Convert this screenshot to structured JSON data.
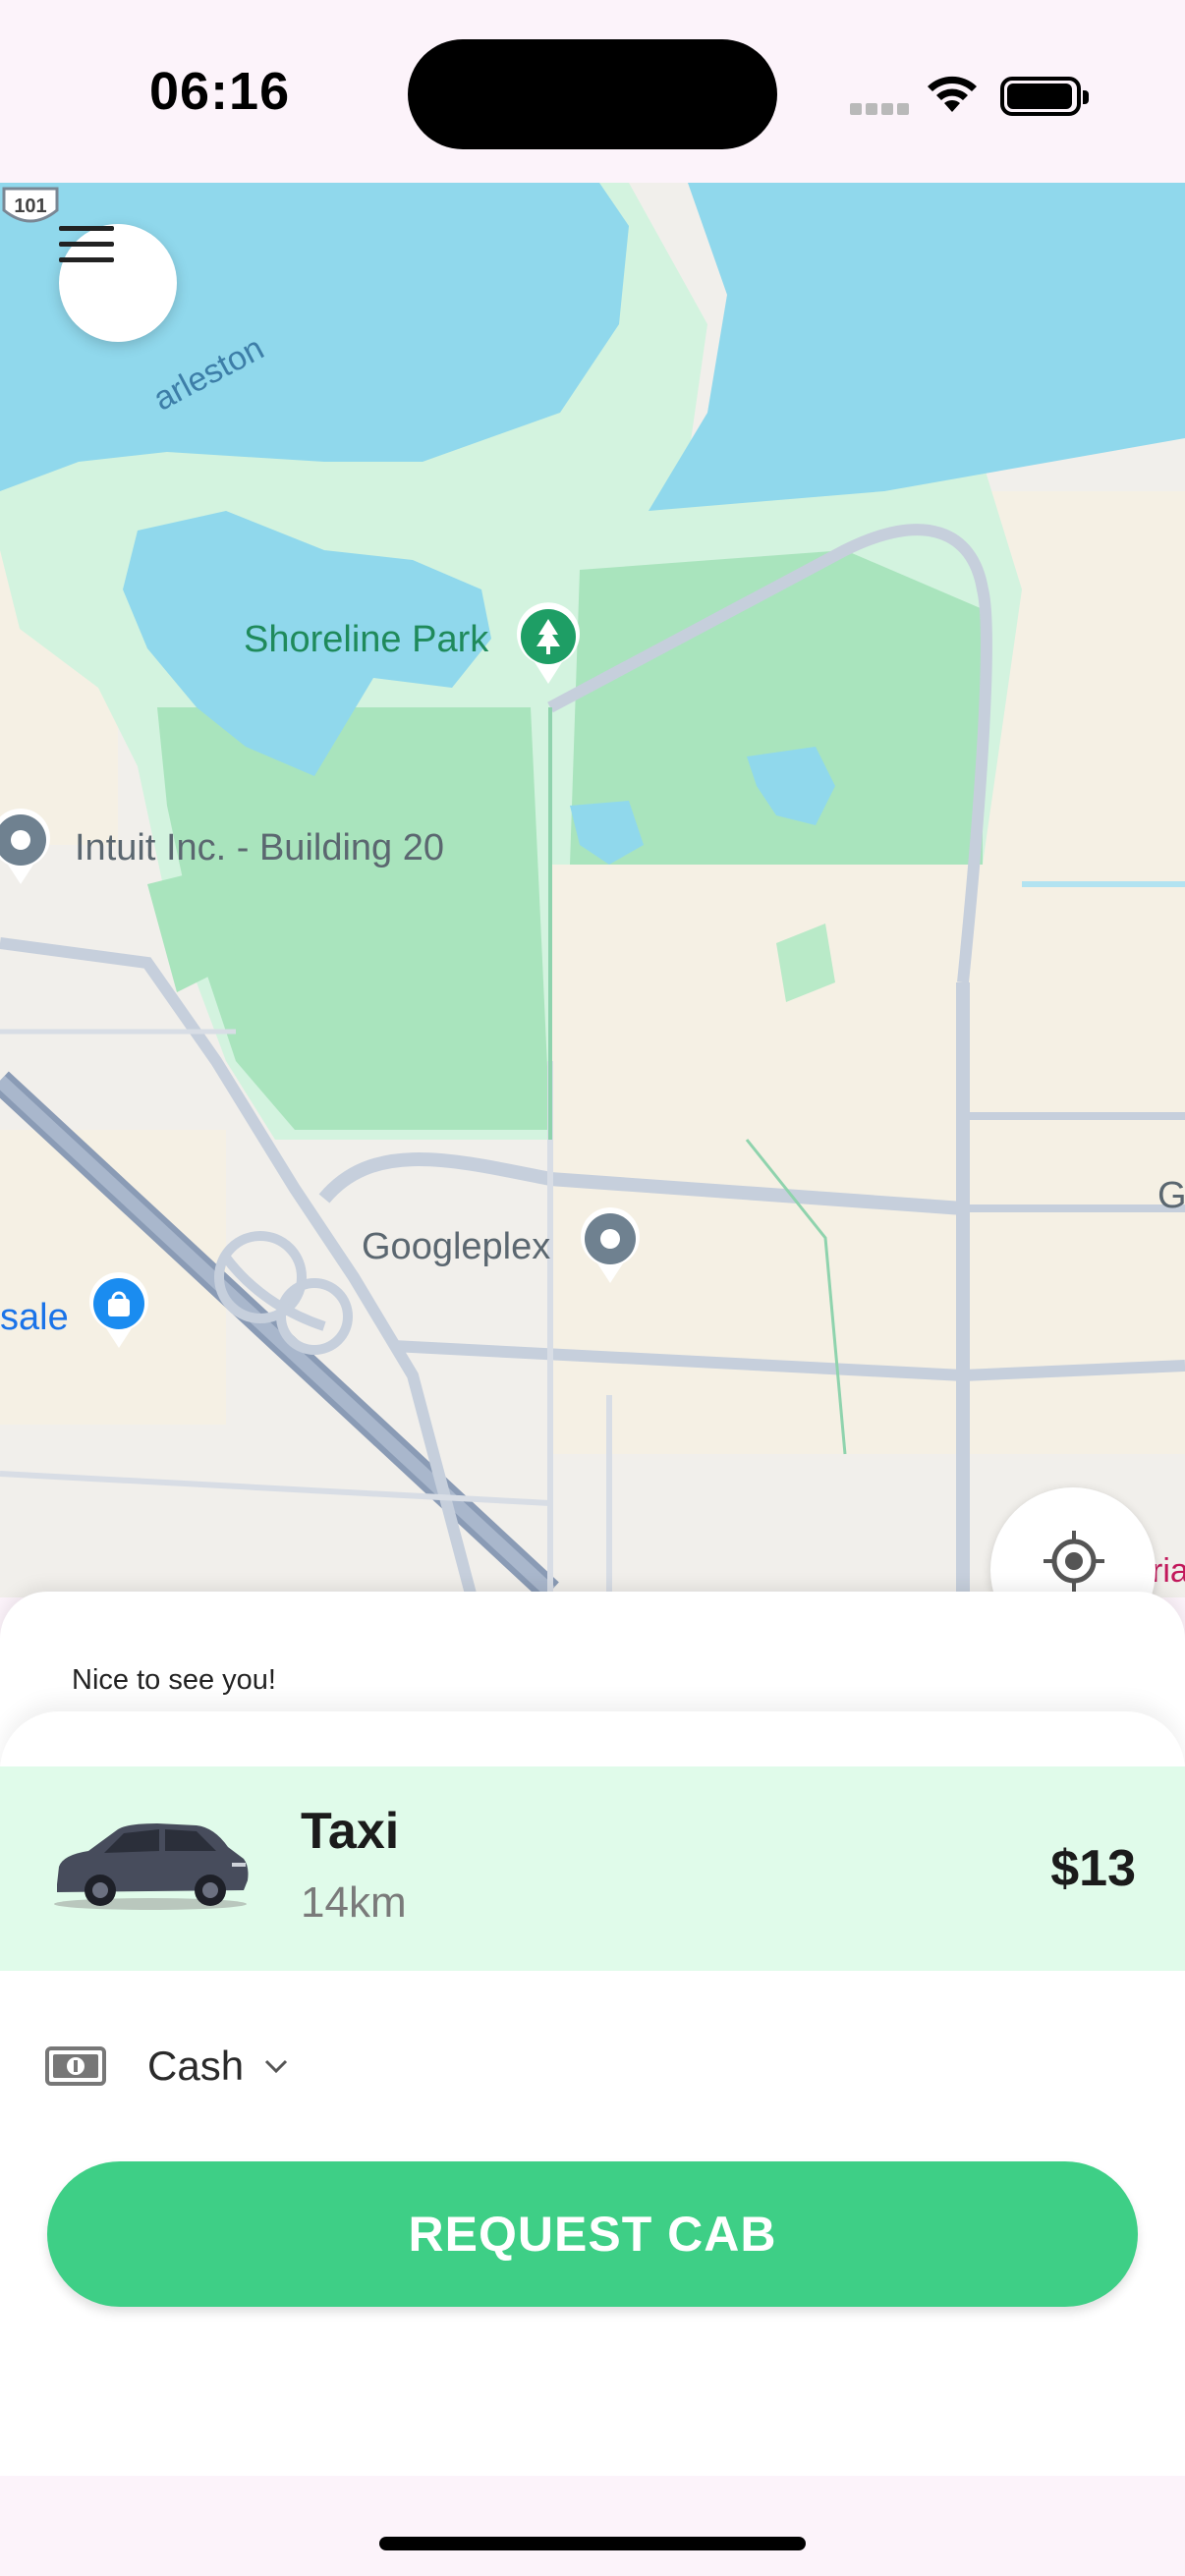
{
  "status_bar": {
    "time": "06:16"
  },
  "map": {
    "labels": {
      "park": "Shoreline Park",
      "intuit": "Intuit Inc. - Building 20",
      "googleplex": "Googleplex",
      "sale": "sale",
      "charleston": "arleston",
      "edge_g": "G",
      "edge_ia": "ria",
      "highway": "101"
    }
  },
  "sheet": {
    "greeting": "Nice to see you!",
    "ride": {
      "name": "Taxi",
      "distance": "14km",
      "price": "$13"
    },
    "payment": {
      "method": "Cash"
    },
    "request_label": "REQUEST CAB"
  },
  "colors": {
    "accent": "#3ecf86",
    "ride_card_bg": "#e0fbea",
    "water": "#90d8ec",
    "park": "#cdeed5"
  },
  "icons": [
    "menu-icon",
    "locate-icon",
    "cash-icon",
    "chevron-down-icon",
    "car-icon",
    "park-pin-icon",
    "place-pin-icon",
    "shopping-pin-icon",
    "wifi-icon",
    "battery-icon"
  ]
}
